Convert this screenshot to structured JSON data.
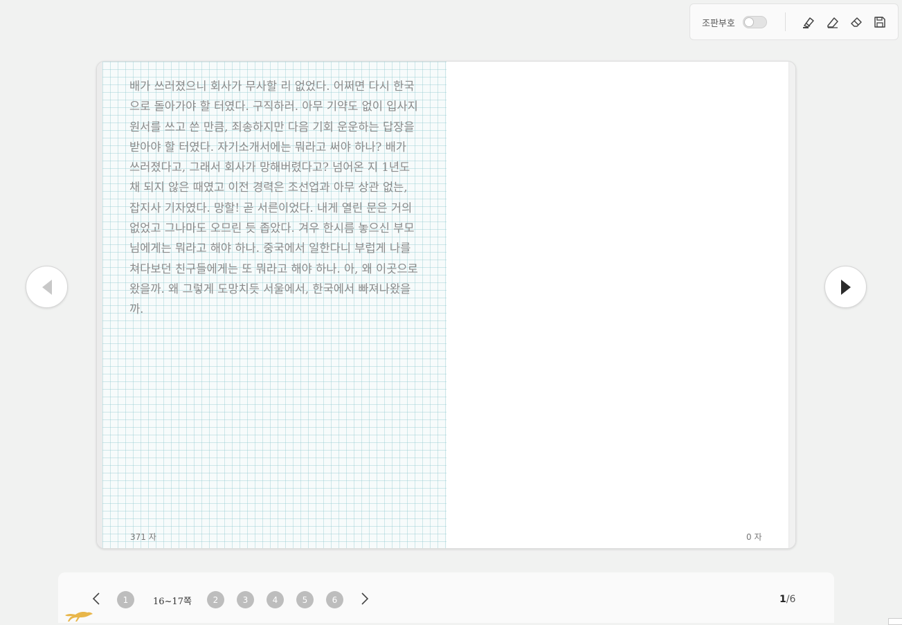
{
  "toolbar": {
    "mode_label": "조판부호",
    "toggle_on": false
  },
  "book": {
    "left_text": "배가 쓰러졌으니 회사가 무사할 리 없었다. 어쩌면 다시 한국으로 돌아가야 할 터였다. 구직하러. 아무 기약도 없이 입사지원서를 쓰고 쓴 만큼, 죄송하지만 다음 기회 운운하는 답장을 받아야 할 터였다. 자기소개서에는 뭐라고 써야 하나? 배가 쓰러졌다고, 그래서 회사가 망해버렸다고? 넘어온 지 1년도 채 되지 않은 때였고 이전 경력은 조선업과 아무 상관 없는, 잡지사 기자였다. 망할! 곧 서른이었다. 내게 열린 문은 거의 없었고 그나마도 오므린 듯 좁았다. 겨우 한시름 놓으신 부모님에게는 뭐라고 해야 하나. 중국에서 일한다니 부럽게 나를 쳐다보던 친구들에게는 또 뭐라고 해야 하나. 아, 왜 이곳으로 왔을까. 왜 그렇게 도망치듯 서울에서, 한국에서 빠져나왔을까.",
    "left_count": "371 자",
    "right_count": "0 자"
  },
  "pager": {
    "pages": [
      "1",
      "2",
      "3",
      "4",
      "5",
      "6"
    ],
    "current_range": "16~17쪽",
    "current_page": "1",
    "total_pages": "/6"
  },
  "colors": {
    "dot": "#bdbdbd",
    "logo": "#e8b64a"
  }
}
